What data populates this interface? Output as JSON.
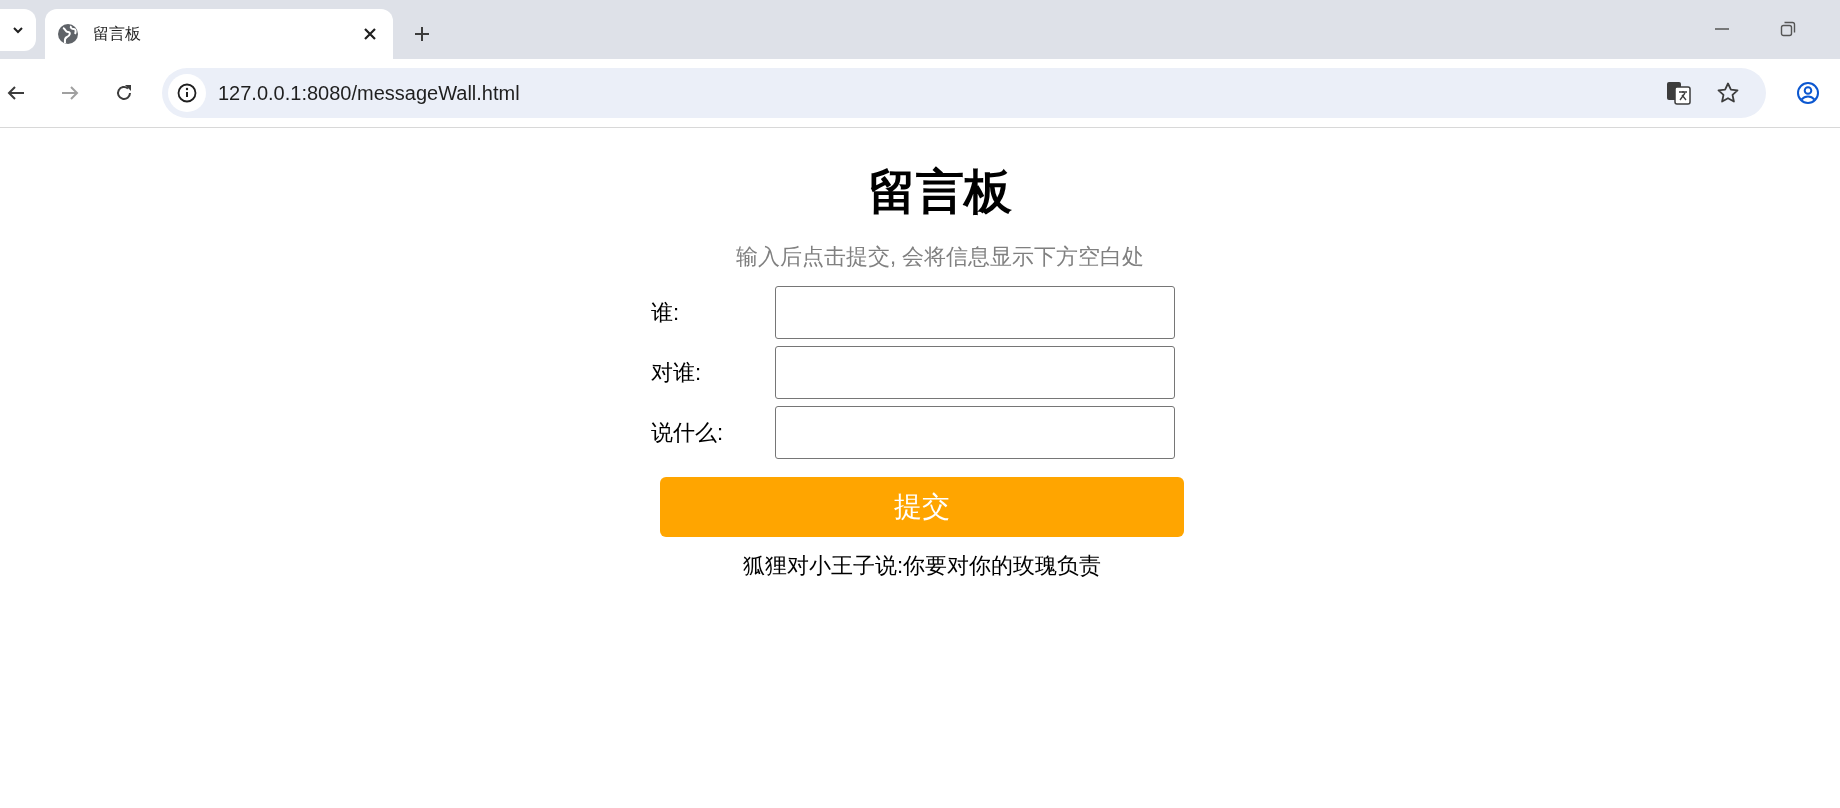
{
  "browser": {
    "tab": {
      "title": "留言板",
      "selected": true
    },
    "url": "127.0.0.1:8080/messageWall.html"
  },
  "page": {
    "title": "留言板",
    "subtitle": "输入后点击提交, 会将信息显示下方空白处",
    "fields": [
      {
        "label": "谁:"
      },
      {
        "label": "对谁:"
      },
      {
        "label": "说什么:"
      }
    ],
    "submit_label": "提交",
    "messages": [
      "狐狸对小王子说:你要对你的玫瑰负责"
    ]
  }
}
